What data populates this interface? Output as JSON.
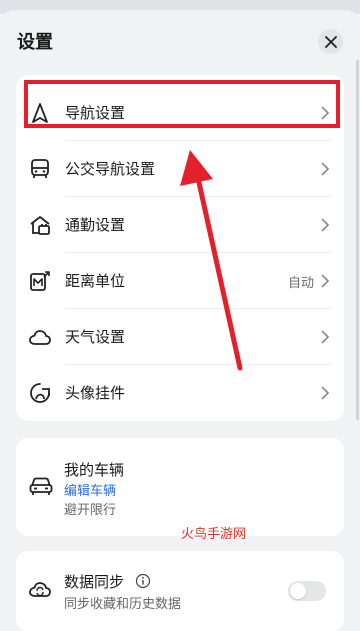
{
  "panel": {
    "title": "设置"
  },
  "menu_items": [
    {
      "label": "导航设置",
      "icon": "navigation-arrow-icon"
    },
    {
      "label": "公交导航设置",
      "icon": "bus-icon"
    },
    {
      "label": "通勤设置",
      "icon": "commute-icon"
    },
    {
      "label": "距离单位",
      "value": "自动",
      "icon": "distance-unit-icon"
    },
    {
      "label": "天气设置",
      "icon": "cloud-icon"
    },
    {
      "label": "头像挂件",
      "icon": "avatar-pendant-icon"
    }
  ],
  "vehicle": {
    "title": "我的车辆",
    "link": "编辑车辆",
    "subtitle": "避开限行"
  },
  "sync": {
    "title": "数据同步",
    "subtitle": "同步收藏和历史数据",
    "enabled": false
  },
  "watermark": "火鸟手游网",
  "colors": {
    "highlight": "#e3202c",
    "link": "#2a6de0"
  }
}
